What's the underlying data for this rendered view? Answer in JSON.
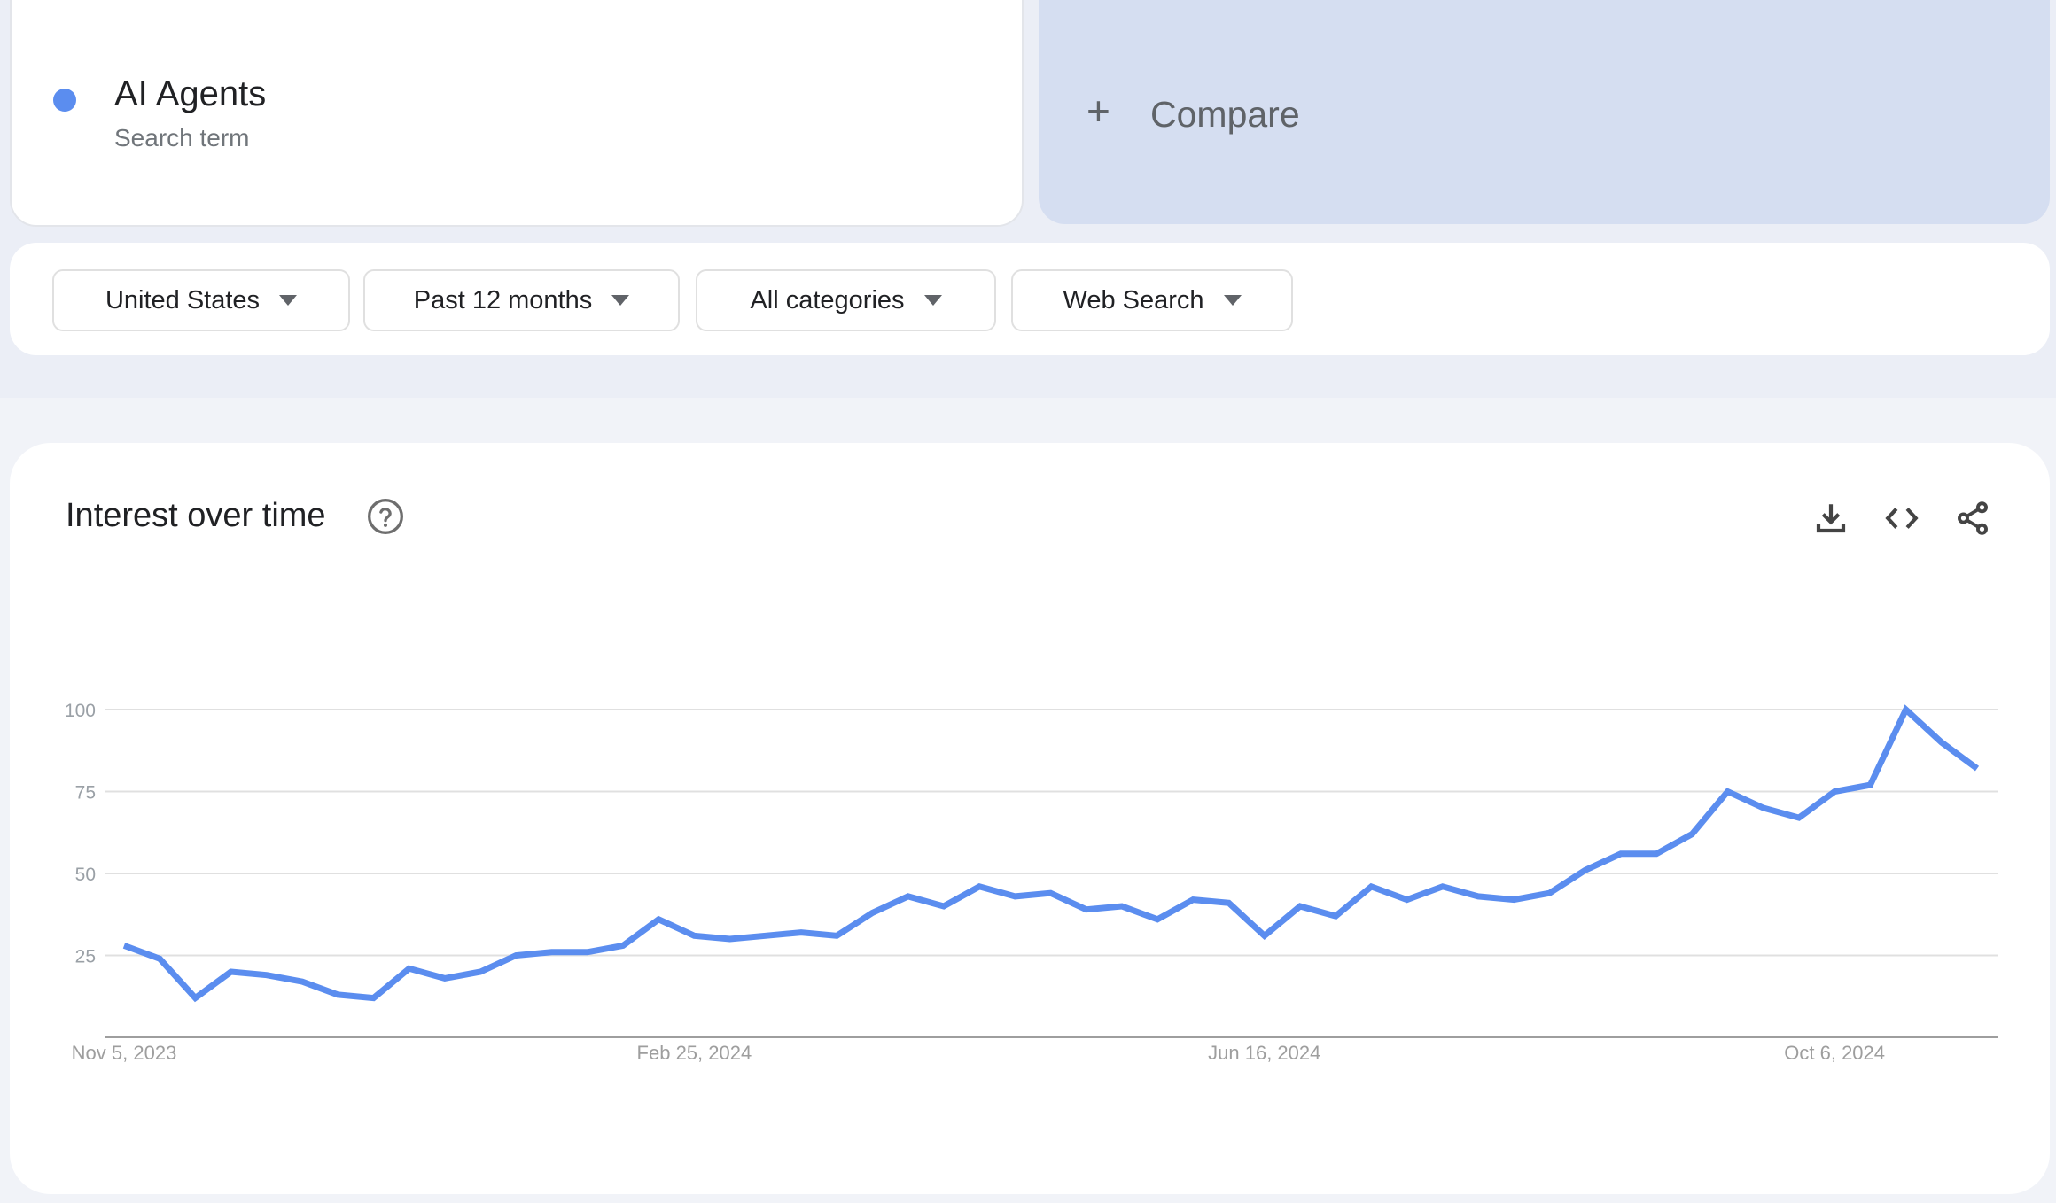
{
  "search_term": {
    "name": "AI Agents",
    "subtitle": "Search term",
    "color": "#5B8DEF"
  },
  "compare": {
    "icon": "plus-icon",
    "label": "Compare"
  },
  "filters": [
    {
      "label": "United States",
      "icon": "caret-down-icon"
    },
    {
      "label": "Past 12 months",
      "icon": "caret-down-icon"
    },
    {
      "label": "All categories",
      "icon": "caret-down-icon"
    },
    {
      "label": "Web Search",
      "icon": "caret-down-icon"
    }
  ],
  "card": {
    "title": "Interest over time",
    "help_icon": "help-circle-icon",
    "actions": [
      "download-icon",
      "embed-code-icon",
      "share-icon"
    ]
  },
  "chart_data": {
    "type": "line",
    "title": "Interest over time",
    "xlabel": "",
    "ylabel": "",
    "ylim": [
      0,
      100
    ],
    "yticks": [
      25,
      50,
      75,
      100
    ],
    "grid": true,
    "x_tick_labels": [
      {
        "label": "Nov 5, 2023",
        "index": 0
      },
      {
        "label": "Feb 25, 2024",
        "index": 16
      },
      {
        "label": "Jun 16, 2024",
        "index": 32
      },
      {
        "label": "Oct 6, 2024",
        "index": 48
      }
    ],
    "x_start": "Nov 5, 2023",
    "x_interval": "weekly",
    "series": [
      {
        "name": "AI Agents",
        "color": "#5B8DEF",
        "values": [
          28,
          24,
          12,
          20,
          19,
          17,
          13,
          12,
          21,
          18,
          20,
          25,
          26,
          26,
          28,
          36,
          31,
          30,
          31,
          32,
          31,
          38,
          43,
          40,
          46,
          43,
          44,
          39,
          40,
          36,
          42,
          41,
          31,
          40,
          37,
          46,
          42,
          46,
          43,
          42,
          44,
          51,
          56,
          56,
          62,
          75,
          70,
          67,
          75,
          77,
          100,
          90,
          82
        ]
      }
    ]
  }
}
